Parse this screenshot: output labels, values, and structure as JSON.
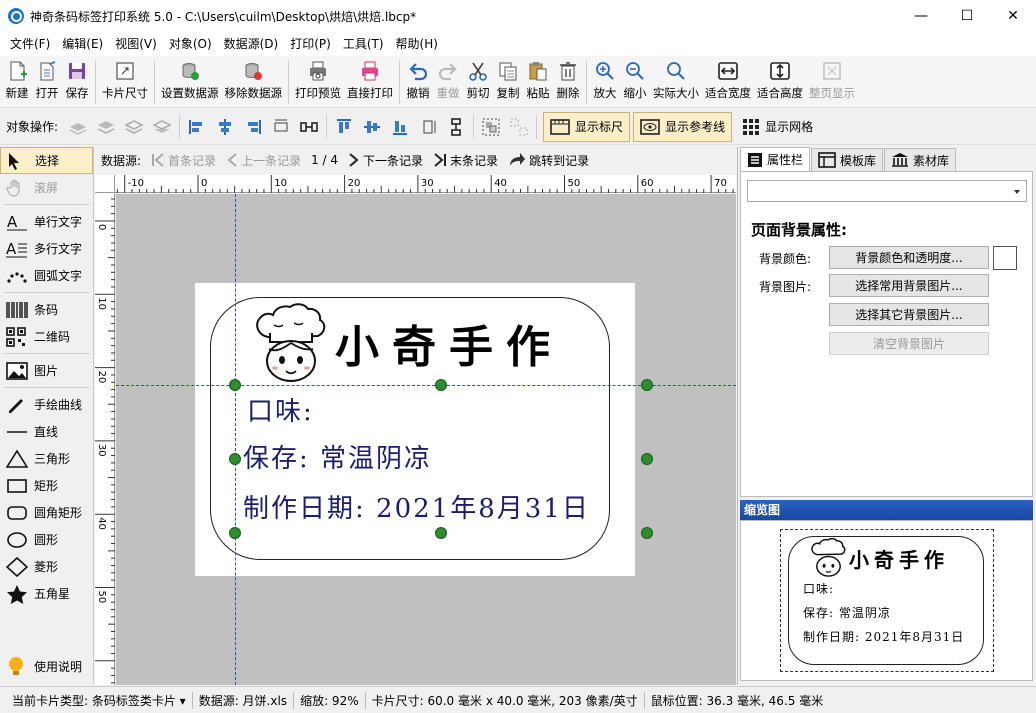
{
  "window": {
    "title": "神奇条码标签打印系统 5.0 - C:\\Users\\cuilm\\Desktop\\烘焙\\烘焙.lbcp*",
    "minimize": "—",
    "maximize": "☐",
    "close": "✕"
  },
  "menu": [
    "文件(F)",
    "编辑(E)",
    "视图(V)",
    "对象(O)",
    "数据源(D)",
    "打印(P)",
    "工具(T)",
    "帮助(H)"
  ],
  "toolbar": {
    "new": "新建",
    "open": "打开",
    "save": "保存",
    "card_size": "卡片尺寸",
    "set_datasource": "设置数据源",
    "remove_datasource": "移除数据源",
    "print_preview": "打印预览",
    "direct_print": "直接打印",
    "undo": "撤销",
    "redo": "重做",
    "cut": "剪切",
    "copy": "复制",
    "paste": "粘贴",
    "delete": "删除",
    "zoom_in": "放大",
    "zoom_out": "缩小",
    "actual_size": "实际大小",
    "fit_width": "适合宽度",
    "fit_height": "适合高度",
    "full_page": "整页显示"
  },
  "objbar": {
    "label": "对象操作:",
    "show_ruler": "显示标尺",
    "show_guides": "显示参考线",
    "show_grid": "显示网格"
  },
  "tools": {
    "select": "选择",
    "scroll": "滚屏",
    "single_text": "单行文字",
    "multi_text": "多行文字",
    "arc_text": "圆弧文字",
    "barcode": "条码",
    "qrcode": "二维码",
    "image": "图片",
    "freehand": "手绘曲线",
    "line": "直线",
    "triangle": "三角形",
    "rect": "矩形",
    "round_rect": "圆角矩形",
    "circle": "圆形",
    "diamond": "菱形",
    "star": "五角星",
    "help": "使用说明"
  },
  "nav": {
    "datasource_label": "数据源:",
    "first": "首条记录",
    "prev": "上一条记录",
    "counter": "1 / 4",
    "next": "下一条记录",
    "last": "末条记录",
    "jump": "跳转到记录"
  },
  "ruler": {
    "top": [
      "-10",
      "0",
      "10",
      "20",
      "30",
      "40",
      "50",
      "60",
      "70"
    ],
    "left": [
      "0",
      "10",
      "20",
      "30",
      "40",
      "50"
    ]
  },
  "label": {
    "title": "小奇手作",
    "flavor": "口味:",
    "storage": "保存: 常温阴凉",
    "date": "制作日期: 2021年8月31日"
  },
  "panel": {
    "tabs": [
      "属性栏",
      "模板库",
      "素材库"
    ],
    "section_title": "页面背景属性:",
    "bg_color_label": "背景颜色:",
    "bg_color_button": "背景颜色和透明度...",
    "bg_image_label": "背景图片:",
    "bg_common_button": "选择常用背景图片...",
    "bg_other_button": "选择其它背景图片...",
    "bg_clear_button": "清空背景图片",
    "preview_title": "缩览图"
  },
  "status": {
    "card_type": "当前卡片类型: 条码标签类卡片 ▾",
    "datasource": "数据源: 月饼.xls",
    "zoom": "缩放: 92%",
    "card_size": "卡片尺寸: 60.0 毫米 x 40.0 毫米, 203 像素/英寸",
    "mouse": "鼠标位置: 36.3 毫米, 46.5 毫米"
  },
  "colors": {
    "accent_toggle": "#fbefc9",
    "guide": "#3348c4",
    "handle": "#2f8c2f",
    "label_text": "#1b1e6e"
  }
}
